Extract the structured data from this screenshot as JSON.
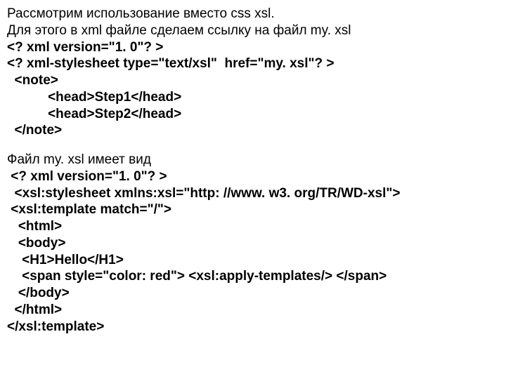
{
  "block1": {
    "p1": "Рассмотрим использование вместо css xsl.",
    "p2": "Для этого в xml файле сделаем ссылку на файл my. xsl",
    "c1": "<? xml version=\"1. 0\"? >",
    "c2": "<? xml-stylesheet type=\"text/xsl\"  href=\"my. xsl\"? >",
    "c3": "  <note>",
    "c4": "           <head>Step1</head>",
    "c5": "           <head>Step2</head>",
    "c6": "  </note>"
  },
  "block2": {
    "p1": "Файл my. xsl имеет вид",
    "c1": " <? xml version=\"1. 0\"? >",
    "c2": "  <xsl:stylesheet xmlns:xsl=\"http: //www. w3. org/TR/WD-xsl\">",
    "c3": " <xsl:template match=\"/\">",
    "c4": "   <html>",
    "c5": "   <body>",
    "c6": "    <H1>Hello</H1>",
    "c7": "    <span style=\"color: red\"> <xsl:apply-templates/> </span>",
    "c8": "   </body>",
    "c9": "  </html>",
    "c10": "</xsl:template>"
  }
}
